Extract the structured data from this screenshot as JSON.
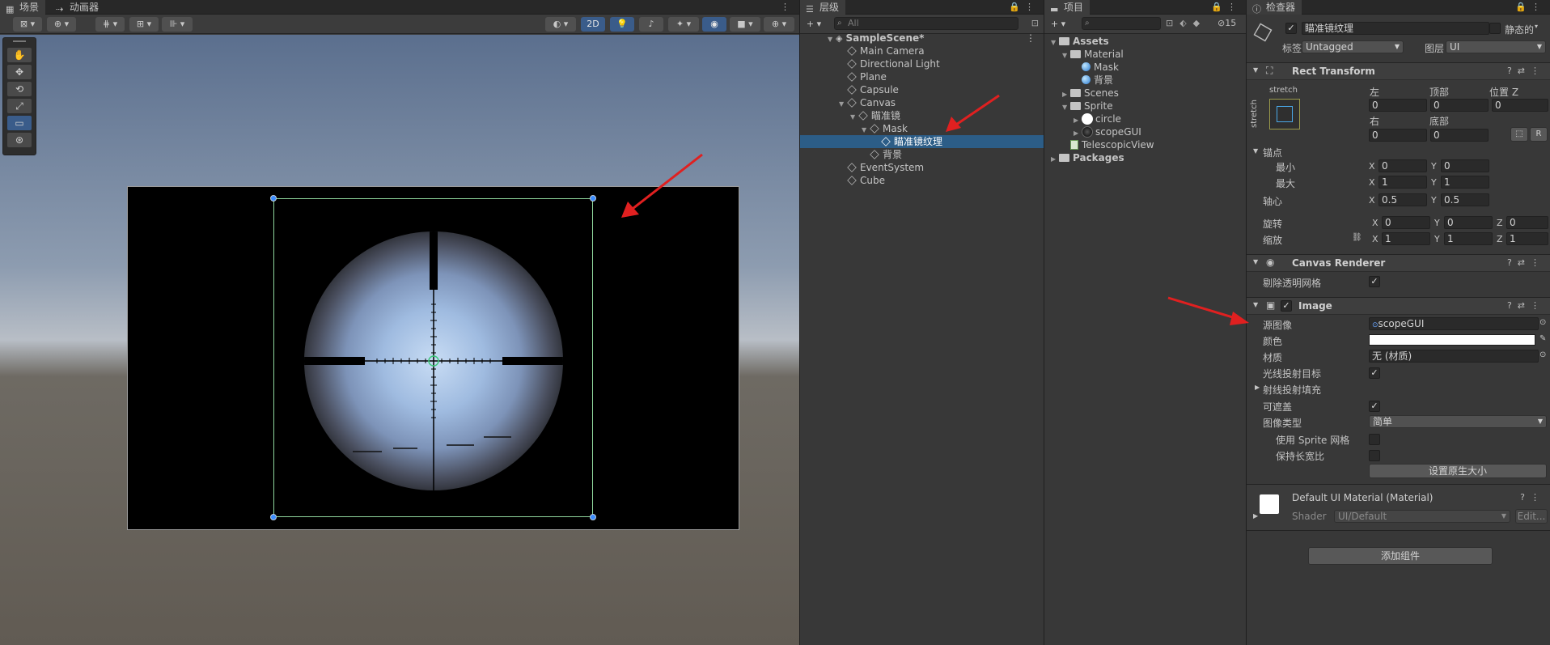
{
  "scene_panel": {
    "tabs": [
      {
        "label": "场景"
      },
      {
        "label": "动画器"
      }
    ],
    "toolbar": {
      "btn_2d": "2D",
      "ground_text_lines": 4
    }
  },
  "hierarchy": {
    "tab_label": "层级",
    "search_placeholder": "All",
    "scene_name": "SampleScene*",
    "items": [
      {
        "label": "Main Camera"
      },
      {
        "label": "Directional Light"
      },
      {
        "label": "Plane"
      },
      {
        "label": "Capsule"
      },
      {
        "label": "Canvas"
      },
      {
        "label": "瞄准镜"
      },
      {
        "label": "Mask"
      },
      {
        "label": "瞄准镜纹理"
      },
      {
        "label": "背景"
      },
      {
        "label": "EventSystem"
      },
      {
        "label": "Cube"
      }
    ]
  },
  "project": {
    "tab_label": "项目",
    "hidden_count": "15",
    "items": [
      {
        "label": "Assets"
      },
      {
        "label": "Material"
      },
      {
        "label": "Mask"
      },
      {
        "label": "背景"
      },
      {
        "label": "Scenes"
      },
      {
        "label": "Sprite"
      },
      {
        "label": "circle"
      },
      {
        "label": "scopeGUI"
      },
      {
        "label": "TelescopicView"
      },
      {
        "label": "Packages"
      }
    ]
  },
  "inspector": {
    "tab_label": "检查器",
    "object_name": "瞄准镜纹理",
    "static_label": "静态的",
    "tag_label": "标签",
    "tag_value": "Untagged",
    "layer_label": "图层",
    "layer_value": "UI",
    "rect_transform": {
      "title": "Rect Transform",
      "anchor_preset": "stretch",
      "anchor_preset_side": "stretch",
      "left_label": "左",
      "top_label": "顶部",
      "posz_label": "位置 Z",
      "left_value": "0",
      "top_value": "0",
      "posz_value": "0",
      "right_label": "右",
      "bottom_label": "底部",
      "right_value": "0",
      "bottom_value": "0",
      "r_button": "R",
      "anchors_label": "锚点",
      "min_label": "最小",
      "min_x": "0",
      "min_y": "0",
      "max_label": "最大",
      "max_x": "1",
      "max_y": "1",
      "pivot_label": "轴心",
      "pivot_x": "0.5",
      "pivot_y": "0.5",
      "rotation_label": "旋转",
      "rot_x": "0",
      "rot_y": "0",
      "rot_z": "0",
      "scale_label": "缩放",
      "scale_x": "1",
      "scale_y": "1",
      "scale_z": "1",
      "x": "X",
      "y": "Y",
      "z": "Z"
    },
    "canvas_renderer": {
      "title": "Canvas Renderer",
      "cull_label": "剔除透明网格"
    },
    "image": {
      "title": "Image",
      "source_label": "源图像",
      "source_value": "scopeGUI",
      "color_label": "颜色",
      "material_label": "材质",
      "material_value": "无 (材质)",
      "raycast_target_label": "光线投射目标",
      "raycast_padding_label": "射线投射填充",
      "maskable_label": "可遮盖",
      "image_type_label": "图像类型",
      "image_type_value": "简单",
      "use_sprite_mesh_label": "使用 Sprite 网格",
      "preserve_aspect_label": "保持长宽比",
      "native_size_button": "设置原生大小"
    },
    "material_box": {
      "title": "Default UI Material (Material)",
      "shader_label": "Shader",
      "shader_value": "UI/Default",
      "edit_button": "Edit..."
    },
    "add_component_button": "添加组件"
  },
  "colors": {
    "selection": "#2c5d87",
    "annotation_arrow": "#e02020",
    "rect_outline": "#8fd79d",
    "handle": "#3a8cff"
  }
}
